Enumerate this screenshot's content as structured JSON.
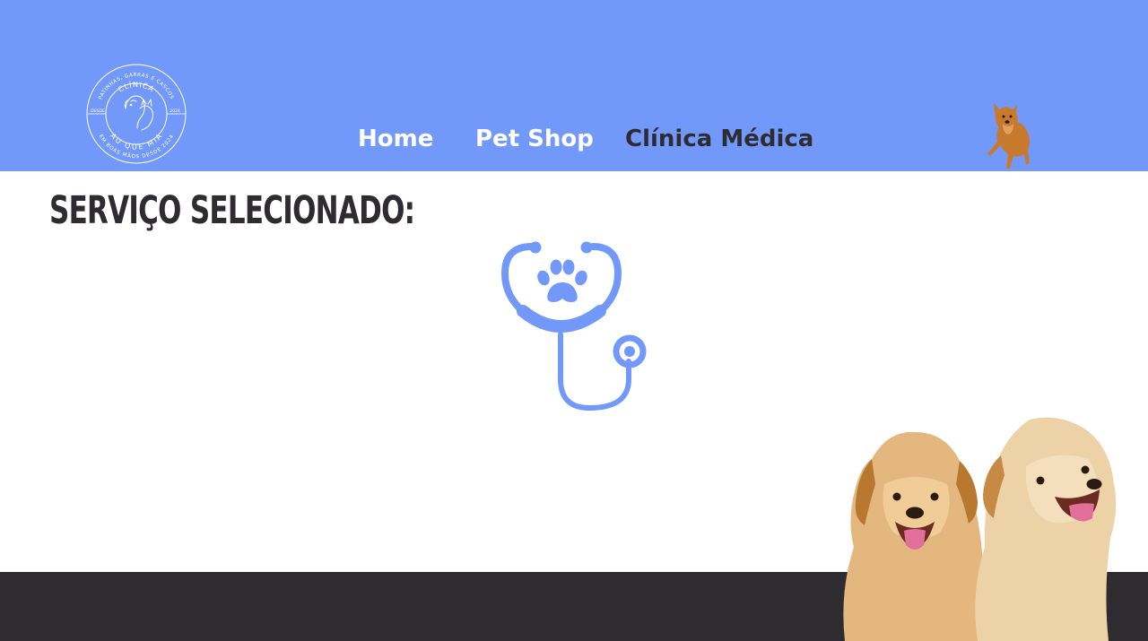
{
  "header": {
    "logo": {
      "top_text": "PATINHAS, GARRAS E CASCOS",
      "name_top": "CLÍNICA",
      "name_bottom": "AU QUE MIA",
      "left_text": "DESDE",
      "right_text": "2024",
      "bottom_text": "EM BOAS MÃOS DESDE 2024"
    },
    "nav": {
      "home": "Home",
      "petshop": "Pet Shop",
      "clinica": "Clínica Médica"
    }
  },
  "main": {
    "title": "SERVIÇO SELECIONADO:",
    "service_icon": "stethoscope-paw-icon"
  },
  "colors": {
    "header_bg": "#7299fa",
    "accent": "#7299fa",
    "dark": "#2e2c31",
    "white": "#ffffff"
  }
}
